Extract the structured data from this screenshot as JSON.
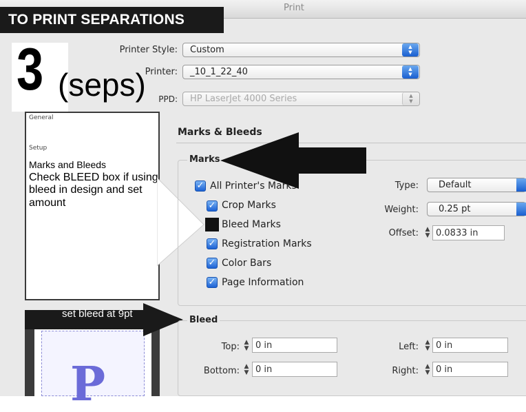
{
  "window": {
    "title": "Print"
  },
  "banner": {
    "text": "TO PRINT SEPARATIONS"
  },
  "step": {
    "number": "3",
    "note": "(seps)"
  },
  "printer_style": {
    "label": "Printer Style:",
    "value": "Custom"
  },
  "printer": {
    "label": "Printer:",
    "value": "_10_1_22_40"
  },
  "ppd": {
    "label": "PPD:",
    "value": "HP LaserJet 4000 Series"
  },
  "sidebar": {
    "items": [
      {
        "label": "General"
      },
      {
        "label": "Setup"
      },
      {
        "label": "Marks and Bleeds"
      }
    ]
  },
  "callout": {
    "text": "Check BLEED box if using bleed in design and set amount"
  },
  "side_arrow": {
    "text": "set bleed at 9pt"
  },
  "preview": {
    "letter": "P"
  },
  "panel": {
    "title": "Marks & Bleeds",
    "marks": {
      "title": "Marks",
      "checkboxes": [
        {
          "label": "All Printer's Marks",
          "checked": true
        },
        {
          "label": "Crop Marks",
          "checked": true
        },
        {
          "label": "Bleed Marks",
          "checked": false
        },
        {
          "label": "Registration Marks",
          "checked": true
        },
        {
          "label": "Color Bars",
          "checked": true
        },
        {
          "label": "Page Information",
          "checked": true
        }
      ],
      "type": {
        "label": "Type:",
        "value": "Default"
      },
      "weight": {
        "label": "Weight:",
        "value": "0.25 pt"
      },
      "offset": {
        "label": "Offset:",
        "value": "0.0833 in"
      }
    },
    "bleed": {
      "title": "Bleed",
      "top": {
        "label": "Top:",
        "value": "0 in"
      },
      "bottom": {
        "label": "Bottom:",
        "value": "0 in"
      },
      "left": {
        "label": "Left:",
        "value": "0 in"
      },
      "right": {
        "label": "Right:",
        "value": "0 in"
      }
    }
  },
  "colors": {
    "accent": "#1c62d4",
    "banner": "#1a1a1a",
    "preview_letter": "#6b6bd8"
  }
}
